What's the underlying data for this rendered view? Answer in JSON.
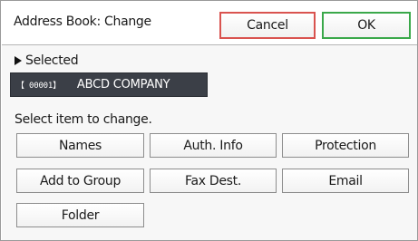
{
  "window": {
    "title": "Address Book: Change",
    "cancel_label": "Cancel",
    "ok_label": "OK"
  },
  "selected": {
    "label": "Selected",
    "code": "【 00001】",
    "name": "ABCD COMPANY"
  },
  "prompt": "Select item to change.",
  "items": {
    "names": "Names",
    "auth_info": "Auth. Info",
    "protection": "Protection",
    "add_to_group": "Add to Group",
    "fax_dest": "Fax Dest.",
    "email": "Email",
    "folder": "Folder"
  },
  "colors": {
    "cancel_border": "#d9534f",
    "ok_border": "#3aa84a",
    "selected_bg": "#3b3f47"
  }
}
